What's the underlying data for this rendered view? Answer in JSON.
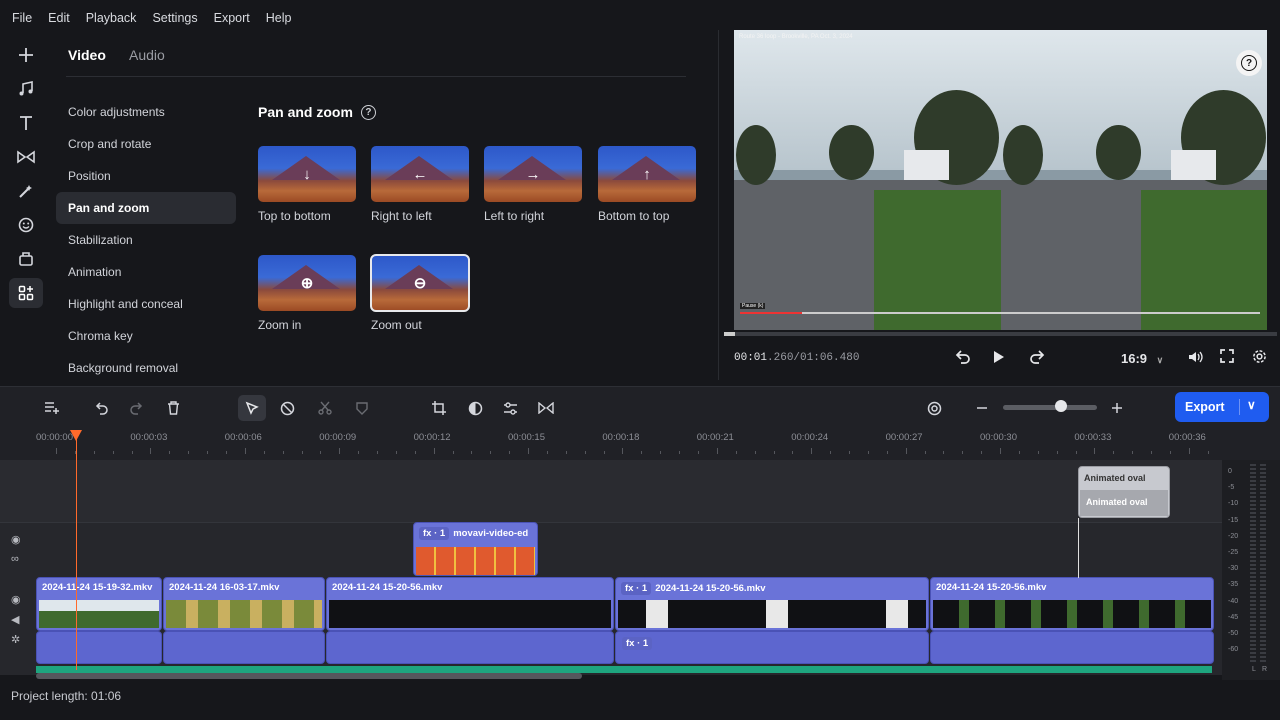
{
  "menu": [
    "File",
    "Edit",
    "Playback",
    "Settings",
    "Export",
    "Help"
  ],
  "rail": [
    {
      "icon": "plus-icon"
    },
    {
      "icon": "music-icon"
    },
    {
      "icon": "text-icon"
    },
    {
      "icon": "transitions-icon"
    },
    {
      "icon": "filters-icon"
    },
    {
      "icon": "sticker-icon"
    },
    {
      "icon": "clip-icon"
    },
    {
      "icon": "more-tools-icon",
      "active": true
    }
  ],
  "tabs": {
    "video": "Video",
    "audio": "Audio"
  },
  "categories": [
    "Color adjustments",
    "Crop and rotate",
    "Position",
    "Pan and zoom",
    "Stabilization",
    "Animation",
    "Highlight and conceal",
    "Chroma key",
    "Background removal"
  ],
  "active_category": "Pan and zoom",
  "section": {
    "title": "Pan and zoom",
    "help": "?"
  },
  "presets": [
    {
      "label": "Top to bottom",
      "arrow": "↓"
    },
    {
      "label": "Right to left",
      "arrow": "←"
    },
    {
      "label": "Left to right",
      "arrow": "→"
    },
    {
      "label": "Bottom to top",
      "arrow": "↑"
    },
    {
      "label": "Zoom in",
      "arrow": "⊕"
    },
    {
      "label": "Zoom out",
      "arrow": "⊖",
      "selected": true
    }
  ],
  "preview": {
    "video_title": "Route 36 loop - Brookville, PA Oct. 3, 2024",
    "pause_tip": "Pause (k)",
    "progress": 0.12,
    "scrub_progress": 0.02,
    "timecode_current": "00:01",
    "timecode_rest": ".260/01:06.480",
    "aspect": "16:9"
  },
  "toolbar": {
    "export_label": "Export",
    "zoom_level": 0.62
  },
  "ruler": [
    "00:00:00",
    "00:00:03",
    "00:00:06",
    "00:00:09",
    "00:00:12",
    "00:00:15",
    "00:00:18",
    "00:00:21",
    "00:00:24",
    "00:00:27",
    "00:00:30",
    "00:00:33",
    "00:00:36"
  ],
  "tracks": {
    "title_clip": {
      "line1": "Animated oval",
      "line2": "Animated oval"
    },
    "overlay_clip": {
      "fx": "fx · 1",
      "name": "movavi-video-ed"
    },
    "video_clips": [
      {
        "name": "2024-11-24 15-19-32.mkv",
        "fx": ""
      },
      {
        "name": "2024-11-24 16-03-17.mkv",
        "fx": ""
      },
      {
        "name": "2024-11-24 15-20-56.mkv",
        "fx": ""
      },
      {
        "name": "2024-11-24 15-20-56.mkv",
        "fx": "fx · 1"
      },
      {
        "name": "2024-11-24 15-20-56.mkv",
        "fx": ""
      }
    ],
    "audio_fx": "fx · 1"
  },
  "meters": [
    "0",
    "-5",
    "-10",
    "-15",
    "-20",
    "-25",
    "-30",
    "-35",
    "-40",
    "-45",
    "-50",
    "-60"
  ],
  "meter_lr": {
    "l": "L",
    "r": "R"
  },
  "status": {
    "project_length": "Project length: 01:06"
  },
  "colors": {
    "accent": "#1f5cf0",
    "clip": "#6a73d8",
    "playhead": "#ff6a2b",
    "audio_bar": "#1ea57f"
  }
}
